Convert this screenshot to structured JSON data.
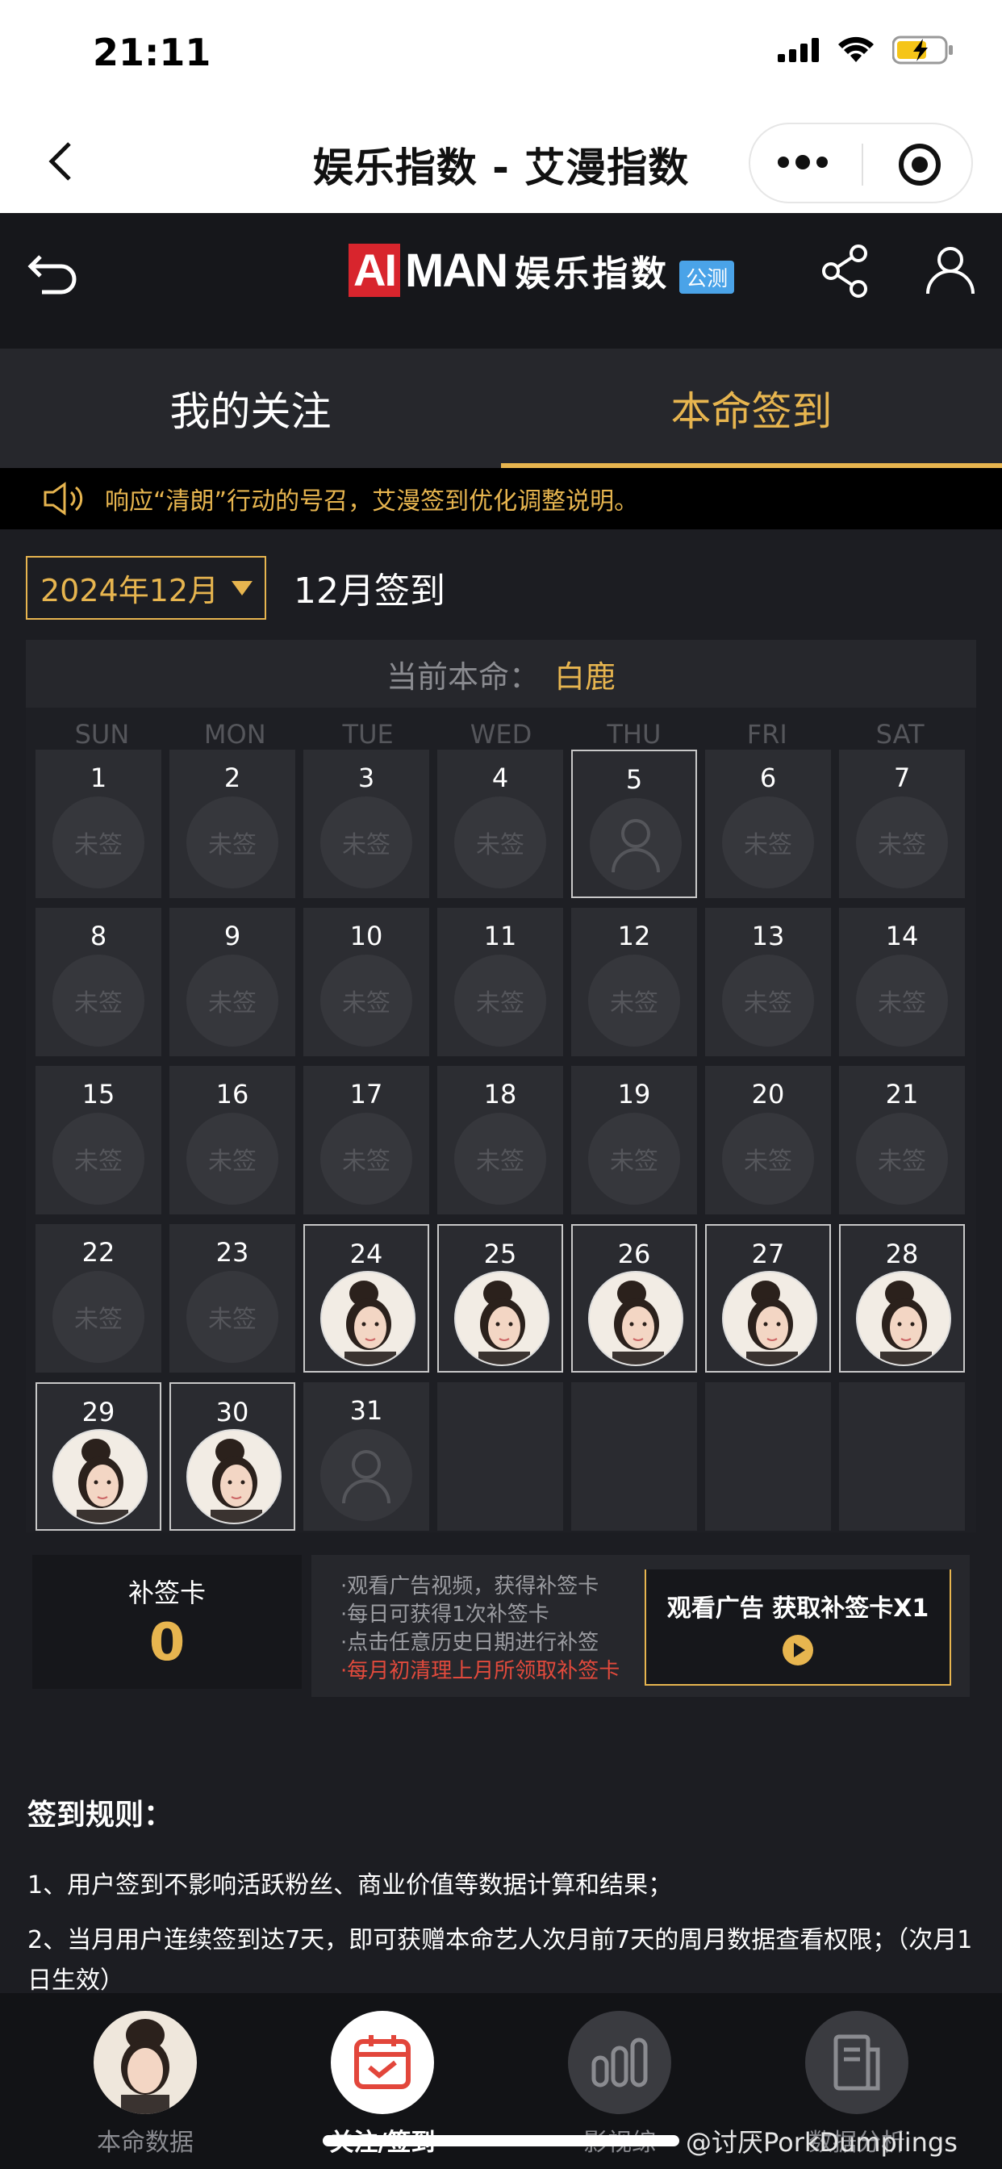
{
  "status": {
    "time": "21:11"
  },
  "nav": {
    "title": "娱乐指数 - 艾漫指数"
  },
  "header": {
    "logo_ai": "AI",
    "logo_man": "MAN",
    "logo_zh": "娱乐指数",
    "beta_badge": "公测"
  },
  "tabs": [
    {
      "label": "我的关注",
      "active": false
    },
    {
      "label": "本命签到",
      "active": true
    }
  ],
  "notice": {
    "text": "响应“清朗”行动的号召，艾漫签到优化调整说明。"
  },
  "calendar": {
    "month_select": "2024年12月",
    "month_title": "12月签到",
    "current_label": "当前本命：",
    "current_value": "白鹿",
    "weekdays": [
      "SUN",
      "MON",
      "TUE",
      "WED",
      "THU",
      "FRI",
      "SAT"
    ],
    "unsigned_label": "未签",
    "days": [
      {
        "d": "1",
        "s": "unsigned"
      },
      {
        "d": "2",
        "s": "unsigned"
      },
      {
        "d": "3",
        "s": "unsigned"
      },
      {
        "d": "4",
        "s": "unsigned"
      },
      {
        "d": "5",
        "s": "today"
      },
      {
        "d": "6",
        "s": "unsigned"
      },
      {
        "d": "7",
        "s": "unsigned"
      },
      {
        "d": "8",
        "s": "unsigned"
      },
      {
        "d": "9",
        "s": "unsigned"
      },
      {
        "d": "10",
        "s": "unsigned"
      },
      {
        "d": "11",
        "s": "unsigned"
      },
      {
        "d": "12",
        "s": "unsigned"
      },
      {
        "d": "13",
        "s": "unsigned"
      },
      {
        "d": "14",
        "s": "unsigned"
      },
      {
        "d": "15",
        "s": "unsigned"
      },
      {
        "d": "16",
        "s": "unsigned"
      },
      {
        "d": "17",
        "s": "unsigned"
      },
      {
        "d": "18",
        "s": "unsigned"
      },
      {
        "d": "19",
        "s": "unsigned"
      },
      {
        "d": "20",
        "s": "unsigned"
      },
      {
        "d": "21",
        "s": "unsigned"
      },
      {
        "d": "22",
        "s": "unsigned"
      },
      {
        "d": "23",
        "s": "unsigned"
      },
      {
        "d": "24",
        "s": "signed"
      },
      {
        "d": "25",
        "s": "signed"
      },
      {
        "d": "26",
        "s": "signed"
      },
      {
        "d": "27",
        "s": "signed"
      },
      {
        "d": "28",
        "s": "signed"
      },
      {
        "d": "29",
        "s": "signed"
      },
      {
        "d": "30",
        "s": "signed"
      },
      {
        "d": "31",
        "s": "future"
      },
      {
        "d": "",
        "s": "empty"
      },
      {
        "d": "",
        "s": "empty"
      },
      {
        "d": "",
        "s": "empty"
      },
      {
        "d": "",
        "s": "empty"
      }
    ]
  },
  "supplement": {
    "title": "补签卡",
    "count": "0",
    "tips": [
      "·观看广告视频，获得补签卡",
      "·每日可获得1次补签卡",
      "·点击任意历史日期进行补签",
      "·每月初清理上月所领取补签卡"
    ],
    "ad_button": "观看广告 获取补签卡X1"
  },
  "rules": {
    "title": "签到规则：",
    "items": [
      "1、用户签到不影响活跃粉丝、商业价值等数据计算和结果；",
      "2、当月用户连续签到达7天，即可获赠本命艺人次月前7天的周月数据查看权限；（次月1日生效）"
    ]
  },
  "bottom_nav": [
    {
      "label": "本命数据"
    },
    {
      "label": "关注/签到"
    },
    {
      "label": "影视综"
    },
    {
      "label": "数据分析"
    }
  ],
  "watermark": "@讨厌PorkDumplings",
  "colors": {
    "accent": "#e7b54f",
    "bg": "#1c1d22",
    "warn": "#e24a3c"
  }
}
